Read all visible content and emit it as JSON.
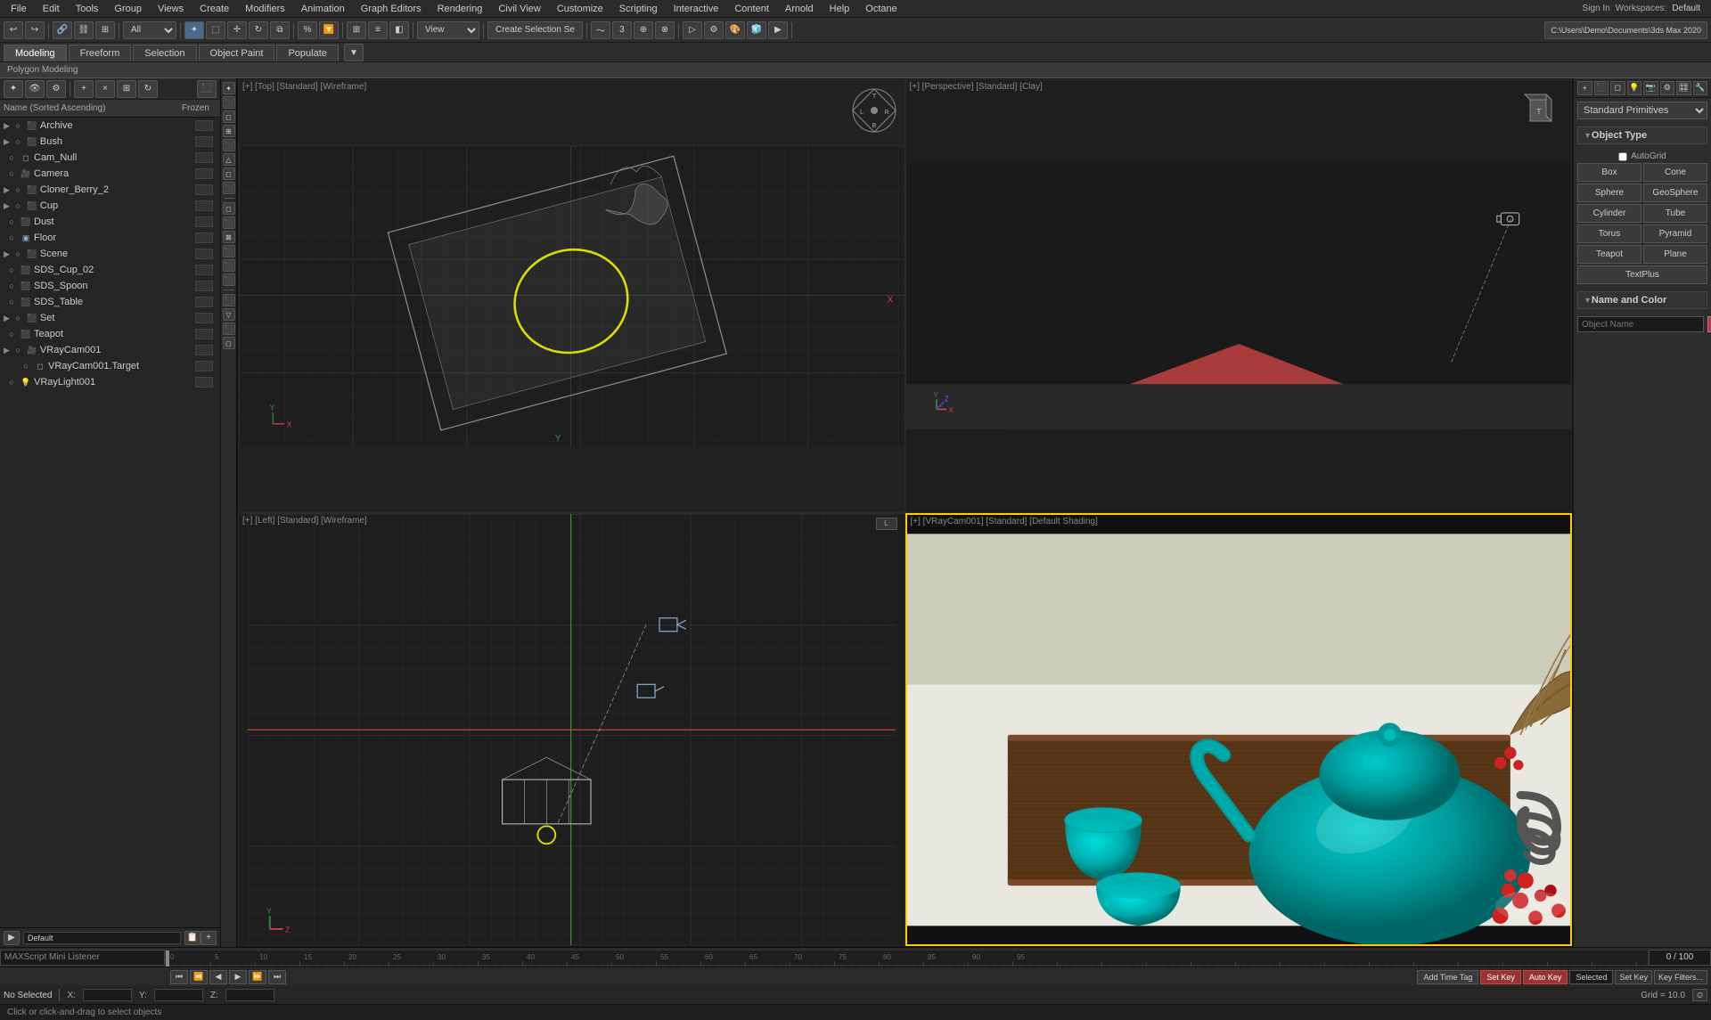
{
  "app": {
    "title": "3ds Max 2020",
    "workspace": "Default",
    "user": "Sign In"
  },
  "menu": {
    "items": [
      "File",
      "Edit",
      "Tools",
      "Group",
      "Views",
      "Create",
      "Modifiers",
      "Animation",
      "Graph Editors",
      "Rendering",
      "Civil View",
      "Customize",
      "Scripting",
      "Interactive",
      "Content",
      "Arnold",
      "Help",
      "Octane"
    ]
  },
  "toolbar": {
    "undo_label": "↩",
    "redo_label": "↪",
    "select_label": "Create Selection Se",
    "workspace_label": "Default",
    "path_label": "C:\\Users\\Demo\\Documents\\3ds Max 2020"
  },
  "tabs": {
    "modeling": "Modeling",
    "freeform": "Freeform",
    "selection": "Selection",
    "object_paint": "Object Paint",
    "populate": "Populate"
  },
  "breadcrumb": "Polygon Modeling",
  "scene_panel": {
    "header": {
      "sort_label": "Name (Sorted Ascending)",
      "frozen_label": "Frozen"
    },
    "items": [
      {
        "name": "Archive",
        "type": "group",
        "indent": 1
      },
      {
        "name": "Bush",
        "type": "group",
        "indent": 1
      },
      {
        "name": "Cam_Null",
        "type": "null",
        "indent": 1
      },
      {
        "name": "Camera",
        "type": "camera",
        "indent": 1
      },
      {
        "name": "Cloner_Berry_2",
        "type": "group",
        "indent": 1
      },
      {
        "name": "Cup",
        "type": "group",
        "indent": 1
      },
      {
        "name": "Dust",
        "type": "object",
        "indent": 1
      },
      {
        "name": "Floor",
        "type": "object",
        "indent": 1
      },
      {
        "name": "Scene",
        "type": "group",
        "indent": 1
      },
      {
        "name": "SDS_Cup_02",
        "type": "object",
        "indent": 1
      },
      {
        "name": "SDS_Spoon",
        "type": "object",
        "indent": 1
      },
      {
        "name": "SDS_Table",
        "type": "object",
        "indent": 1
      },
      {
        "name": "Set",
        "type": "group",
        "indent": 1
      },
      {
        "name": "Teapot",
        "type": "object",
        "indent": 1
      },
      {
        "name": "VRayCam001",
        "type": "camera",
        "indent": 1
      },
      {
        "name": "VRayCam001.Target",
        "type": "target",
        "indent": 2
      },
      {
        "name": "VRayLight001",
        "type": "light",
        "indent": 1
      }
    ]
  },
  "viewports": {
    "top": {
      "label": "[+] [Top] [Standard] [Wireframe]"
    },
    "perspective": {
      "label": "[+] [Perspective] [Standard] [Clay]"
    },
    "left": {
      "label": "[+] [Left] [Standard] [Wireframe]"
    },
    "camera": {
      "label": "[+] [VRayCam001] [Standard] [Default Shading]"
    }
  },
  "right_panel": {
    "dropdown_label": "Standard Primitives",
    "object_type_label": "Object Type",
    "autogrid_label": "AutoGrid",
    "buttons": [
      "Box",
      "Cone",
      "Sphere",
      "GeoSphere",
      "Cylinder",
      "Tube",
      "Torus",
      "Pyramid",
      "Teapot",
      "Plane",
      "TextPlus"
    ],
    "name_color_label": "Name and Color"
  },
  "status": {
    "selected": "No Selected",
    "hint": "Click or click-and-drag to select objects",
    "x_label": "X:",
    "y_label": "Y:",
    "z_label": "Z:",
    "x_val": "",
    "y_val": "",
    "z_val": "",
    "grid_label": "Grid = 10.0",
    "minilistener_label": "MAXScript Mini Listener",
    "selected_label": "Selected",
    "frame": "0 / 100"
  },
  "timeline": {
    "frame": "0 / 100",
    "add_time_tag": "Add Time Tag",
    "set_key": "Set Key",
    "key_filters": "Key Filters..."
  }
}
